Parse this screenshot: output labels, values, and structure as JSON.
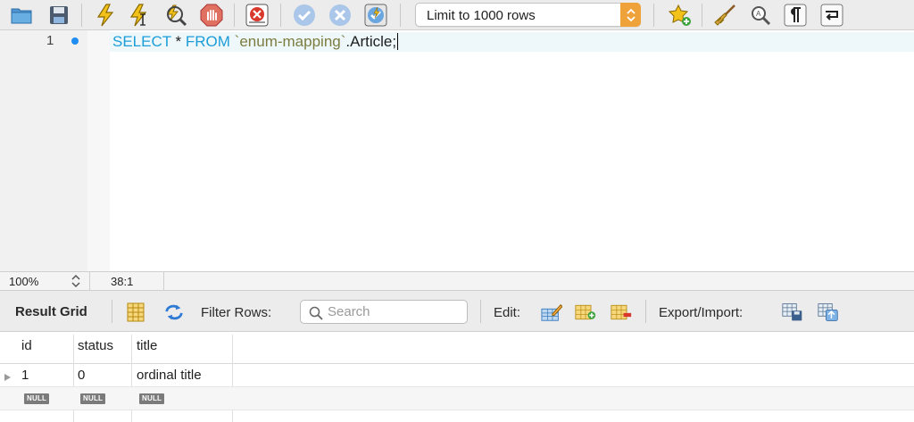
{
  "toolbar": {
    "buttons": [
      {
        "icon": "folder-icon",
        "label": "Open SQL script"
      },
      {
        "icon": "save-icon",
        "label": "Save script"
      },
      {
        "icon": "lightning-icon",
        "label": "Execute"
      },
      {
        "icon": "lightning-cursor-icon",
        "label": "Execute current statement"
      },
      {
        "icon": "explain-magnifier-icon",
        "label": "Explain"
      },
      {
        "icon": "stop-icon",
        "label": "Stop"
      },
      {
        "icon": "toggle-error-icon",
        "label": "Toggle stop on error"
      },
      {
        "icon": "commit-check-icon",
        "label": "Commit"
      },
      {
        "icon": "rollback-x-icon",
        "label": "Rollback"
      },
      {
        "icon": "autocommit-icon",
        "label": "Toggle autocommit"
      }
    ],
    "limit_select": {
      "value": "Limit to 1000 rows"
    },
    "right_buttons": [
      {
        "icon": "star-add-icon",
        "label": "Add snippet"
      },
      {
        "icon": "broom-icon",
        "label": "Beautify"
      },
      {
        "icon": "find-icon",
        "label": "Find"
      },
      {
        "icon": "pilcrow-icon",
        "label": "Invisible characters"
      },
      {
        "icon": "wrap-icon",
        "label": "Word wrap"
      }
    ]
  },
  "editor": {
    "line_number": "1",
    "sql": {
      "kw1": "SELECT",
      "star": " * ",
      "kw2": "FROM",
      "space": " ",
      "schema": "`enum-mapping`",
      "rest": ".Article;"
    }
  },
  "status": {
    "zoom": "100%",
    "cursor_pos": "38:1"
  },
  "result_toolbar": {
    "title": "Result Grid",
    "filter_label": "Filter Rows:",
    "search_placeholder": "Search",
    "edit_label": "Edit:",
    "export_label": "Export/Import:"
  },
  "grid": {
    "columns": [
      "id",
      "status",
      "title"
    ],
    "rows": [
      {
        "id": "1",
        "status": "0",
        "title": "ordinal title"
      },
      {
        "id": "NULL",
        "status": "NULL",
        "title": "NULL"
      }
    ]
  },
  "colors": {
    "keyword": "#1c9dd8",
    "string": "#7c7c40",
    "accent_orange": "#f0a23a",
    "breakpoint_blue": "#1f8ef0"
  }
}
